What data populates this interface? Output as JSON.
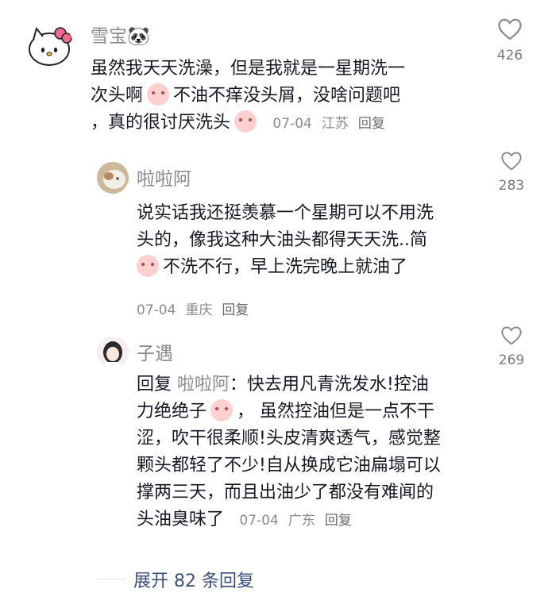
{
  "comments": [
    {
      "username": "雪宝🐼",
      "lines": [
        "虽然我天天洗澡，但是我就是一星期洗一",
        "次头啊",
        "不油不痒没头屑，没啥问题吧",
        "，真的很讨厌洗头"
      ],
      "date": "07-04",
      "location": "江苏",
      "reply_label": "回复",
      "likes": "426"
    },
    {
      "username": "啦啦阿",
      "lines": [
        "说实话我还挺羡慕一个星期可以不用洗",
        "头的，像我这种大油头都得天天洗..简",
        "不洗不行，早上洗完晚上就油了"
      ],
      "date": "07-04",
      "location": "重庆",
      "reply_label": "回复",
      "likes": "283"
    },
    {
      "username": "子遇",
      "reply_prefix": "回复",
      "mention": "啦啦阿",
      "lines": [
        "：快去用凡青洗发水!控油",
        "力绝绝子",
        "， 虽然控油但是一点不干",
        "涩，吹干很柔顺!头皮清爽透气，感觉整",
        "颗头都轻了不少!自从换成它油扁塌可以",
        "撑两三天，而且出油少了都没有难闻的",
        "头油臭味了"
      ],
      "date": "07-04",
      "location": "广东",
      "reply_label": "回复",
      "likes": "269"
    }
  ],
  "expand_label": "展开 82 条回复",
  "colors": {
    "text": "#161823",
    "secondary": "#8a8a8f"
  },
  "icons": {
    "like": "heart-outline-icon",
    "emoji": "crying-face-emoji-icon"
  }
}
